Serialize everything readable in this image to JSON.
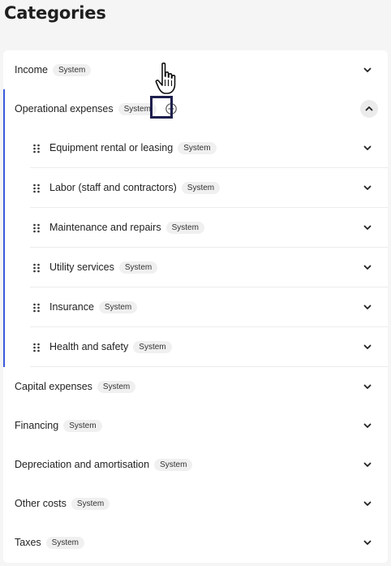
{
  "page": {
    "title": "Categories"
  },
  "badge_text": "System",
  "categories": [
    {
      "label": "Income",
      "badge": "System"
    },
    {
      "label": "Operational expenses",
      "badge": "System",
      "expanded": true,
      "subcategories": [
        {
          "label": "Equipment rental or leasing",
          "badge": "System"
        },
        {
          "label": "Labor (staff and contractors)",
          "badge": "System"
        },
        {
          "label": "Maintenance and repairs",
          "badge": "System"
        },
        {
          "label": "Utility services",
          "badge": "System"
        },
        {
          "label": "Insurance",
          "badge": "System"
        },
        {
          "label": "Health and safety",
          "badge": "System"
        }
      ]
    },
    {
      "label": "Capital expenses",
      "badge": "System"
    },
    {
      "label": "Financing",
      "badge": "System"
    },
    {
      "label": "Depreciation and amortisation",
      "badge": "System"
    },
    {
      "label": "Other costs",
      "badge": "System"
    },
    {
      "label": "Taxes",
      "badge": "System"
    }
  ],
  "icons": {
    "chevron": "chevron-down-icon",
    "collapse": "chevron-up-icon",
    "add": "add-circle-icon",
    "drag": "drag-handle-icon",
    "cursor": "hand-pointer-icon"
  },
  "colors": {
    "accent_bar": "#3b5bdb",
    "focus_outline": "#1d1f4d"
  }
}
